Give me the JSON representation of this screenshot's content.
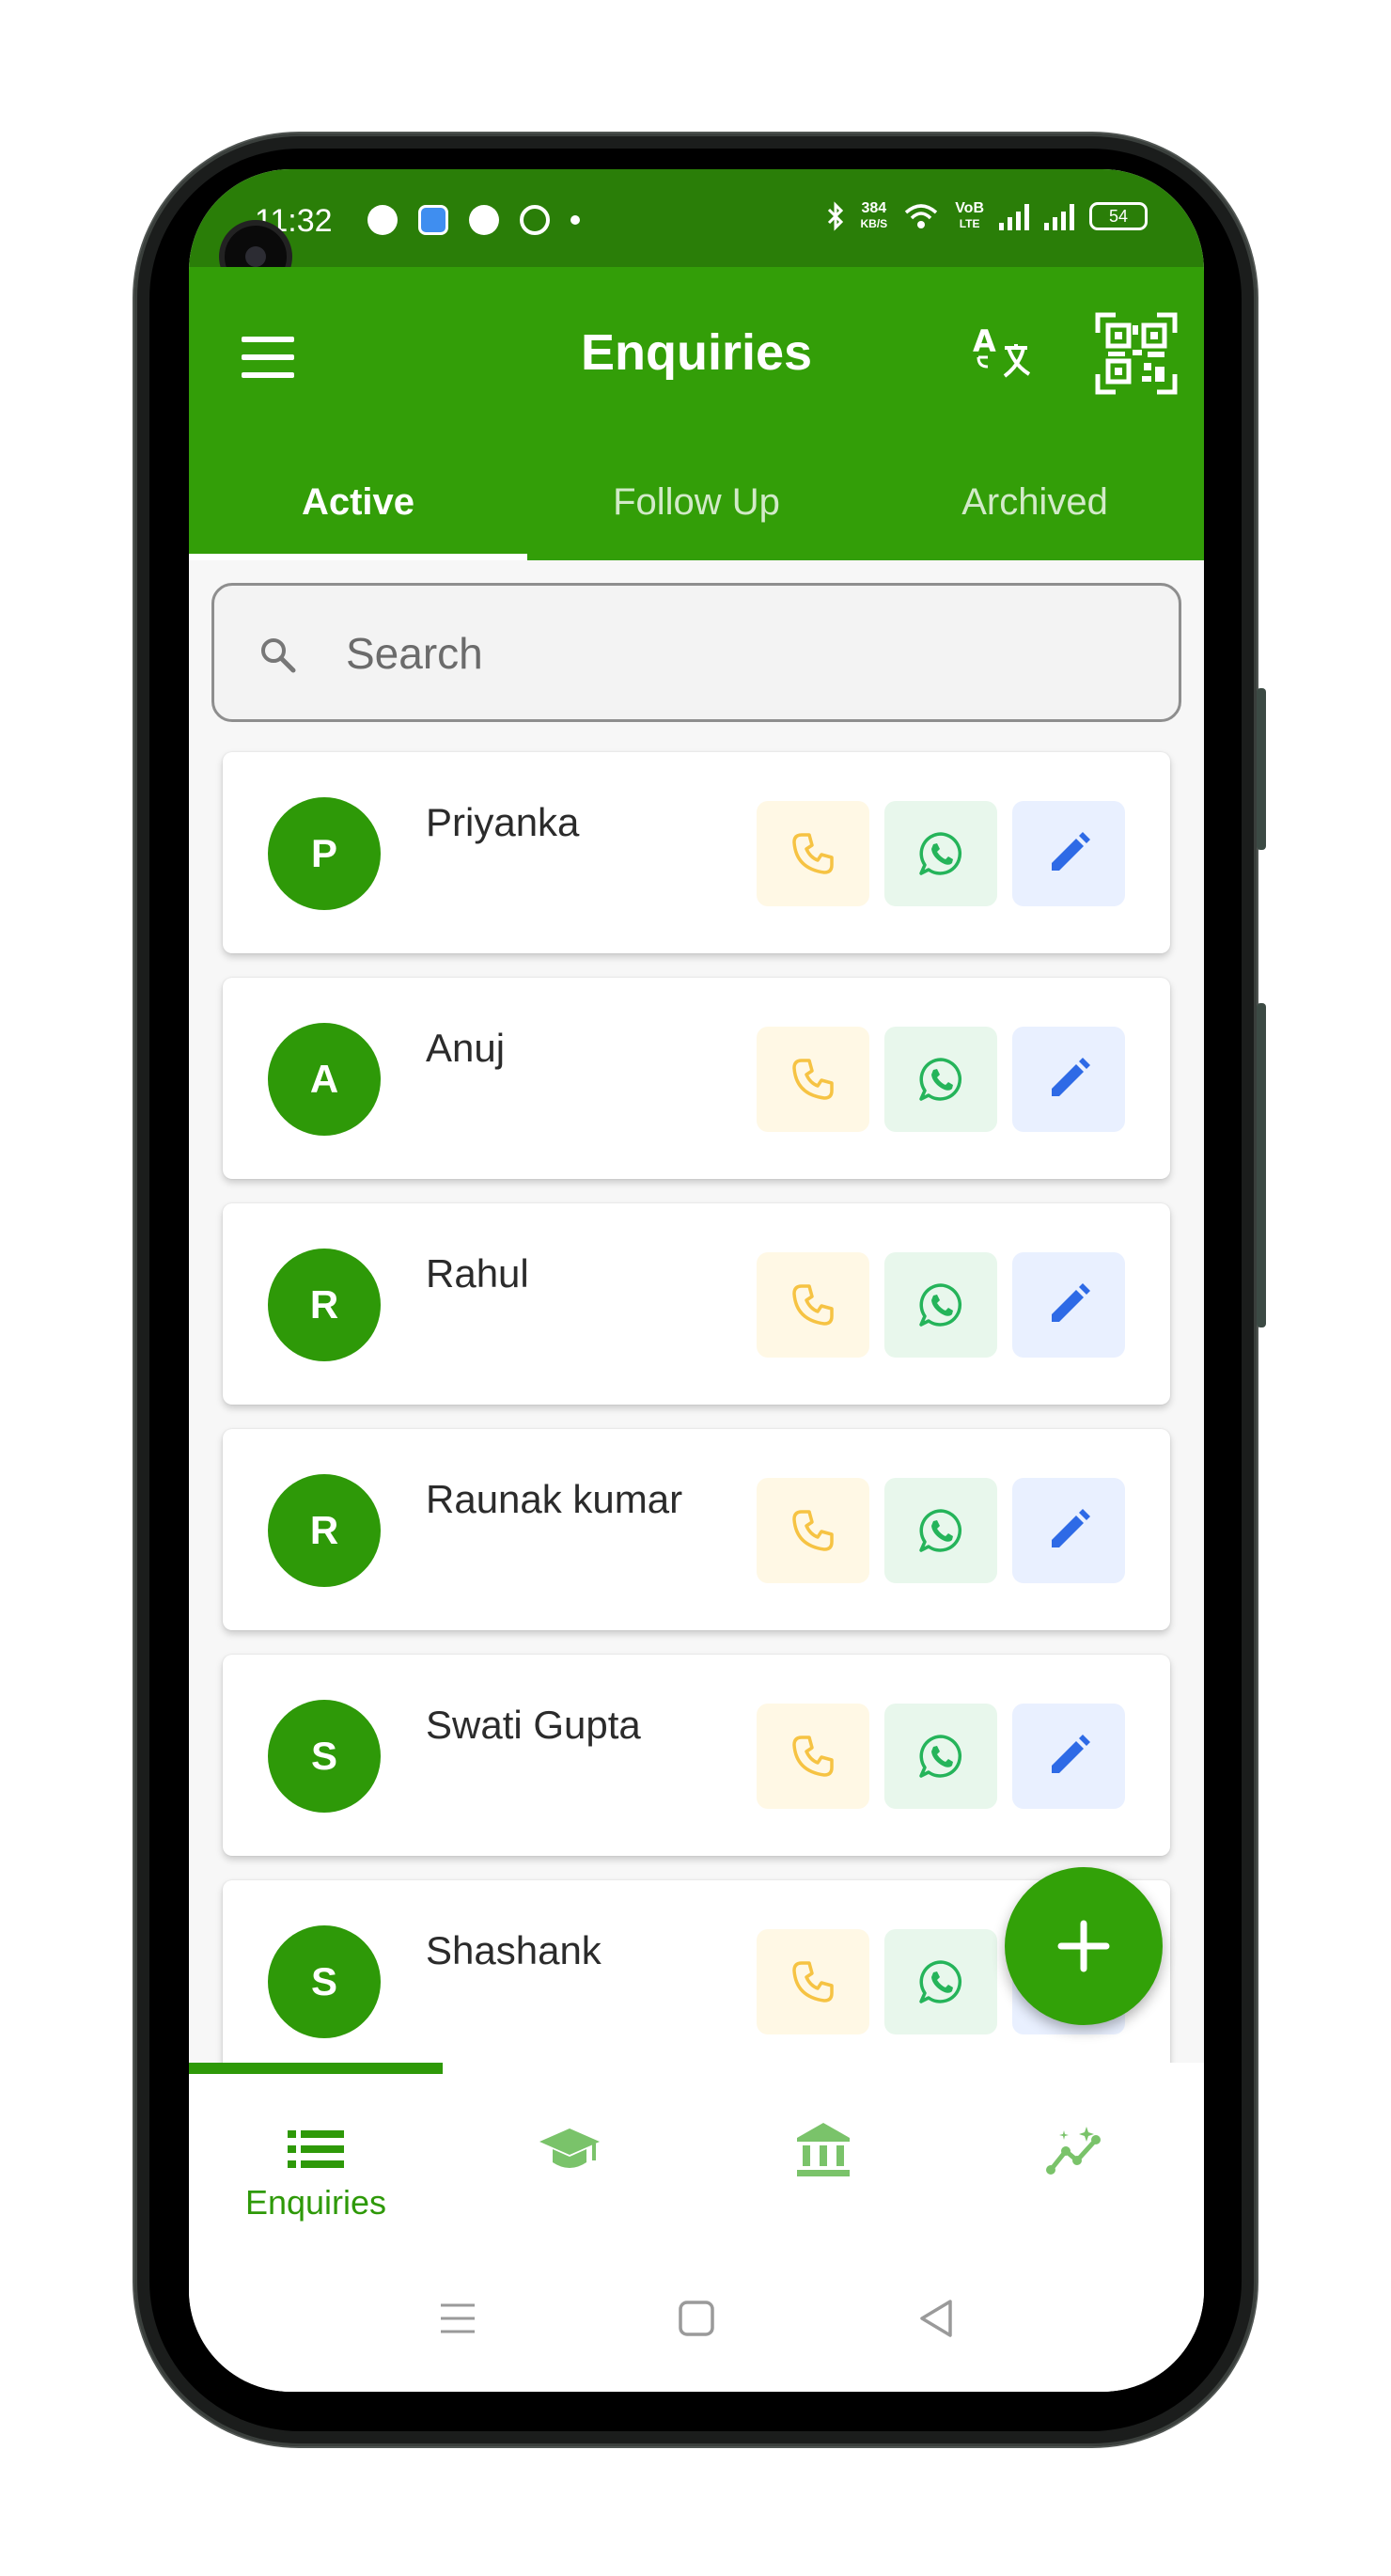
{
  "status_bar": {
    "time": "11:32",
    "net_speed_top": "384",
    "net_speed_bottom": "KB/S",
    "volte_top": "VoB",
    "volte_bottom": "LTE",
    "battery": "54"
  },
  "app_bar": {
    "title": "Enquiries",
    "color": "#339e08"
  },
  "tabs": [
    {
      "label": "Active",
      "selected": true
    },
    {
      "label": "Follow Up",
      "selected": false
    },
    {
      "label": "Archived",
      "selected": false
    }
  ],
  "search": {
    "placeholder": "Search",
    "value": ""
  },
  "enquiries": [
    {
      "initial": "P",
      "name": "Priyanka"
    },
    {
      "initial": "A",
      "name": "Anuj"
    },
    {
      "initial": "R",
      "name": "Rahul"
    },
    {
      "initial": "R",
      "name": "Raunak kumar"
    },
    {
      "initial": "S",
      "name": "Swati Gupta"
    },
    {
      "initial": "S",
      "name": "Shashank"
    }
  ],
  "bottom_nav": [
    {
      "icon": "list-icon",
      "label": "Enquiries",
      "selected": true
    },
    {
      "icon": "graduation-cap-icon",
      "label": "",
      "selected": false
    },
    {
      "icon": "bank-icon",
      "label": "",
      "selected": false
    },
    {
      "icon": "insights-icon",
      "label": "",
      "selected": false
    }
  ],
  "colors": {
    "primary": "#339e08",
    "call": "#f6c343",
    "whatsapp": "#25b45a",
    "edit": "#2e6ae6"
  }
}
